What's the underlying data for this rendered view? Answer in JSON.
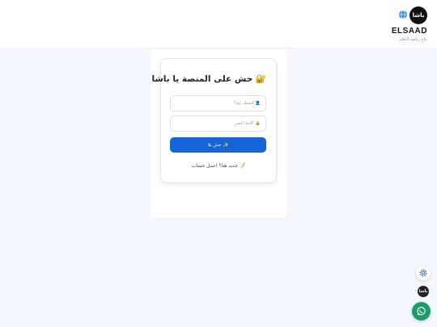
{
  "header": {
    "logo_text": "باشا",
    "brand_name": "ELSAAD",
    "tagline": "بتاع رياضه التعلم"
  },
  "login": {
    "title": "🔐 خش على المنصة يا باشا",
    "username_placeholder": "👤 اسمك إيه؟",
    "password_placeholder": "🔒 كلمة السر",
    "submit_label": "✨ خش يلا",
    "register_text": "📝 جديد هنا؟ اعمل حساب"
  },
  "floating": {
    "settings_icon": "gear-icon",
    "avatar_text": "باشا",
    "whatsapp_icon": "whatsapp-icon"
  },
  "colors": {
    "accent": "#1565d8",
    "background": "#f4f7fe",
    "whatsapp": "#1f9c6a"
  }
}
